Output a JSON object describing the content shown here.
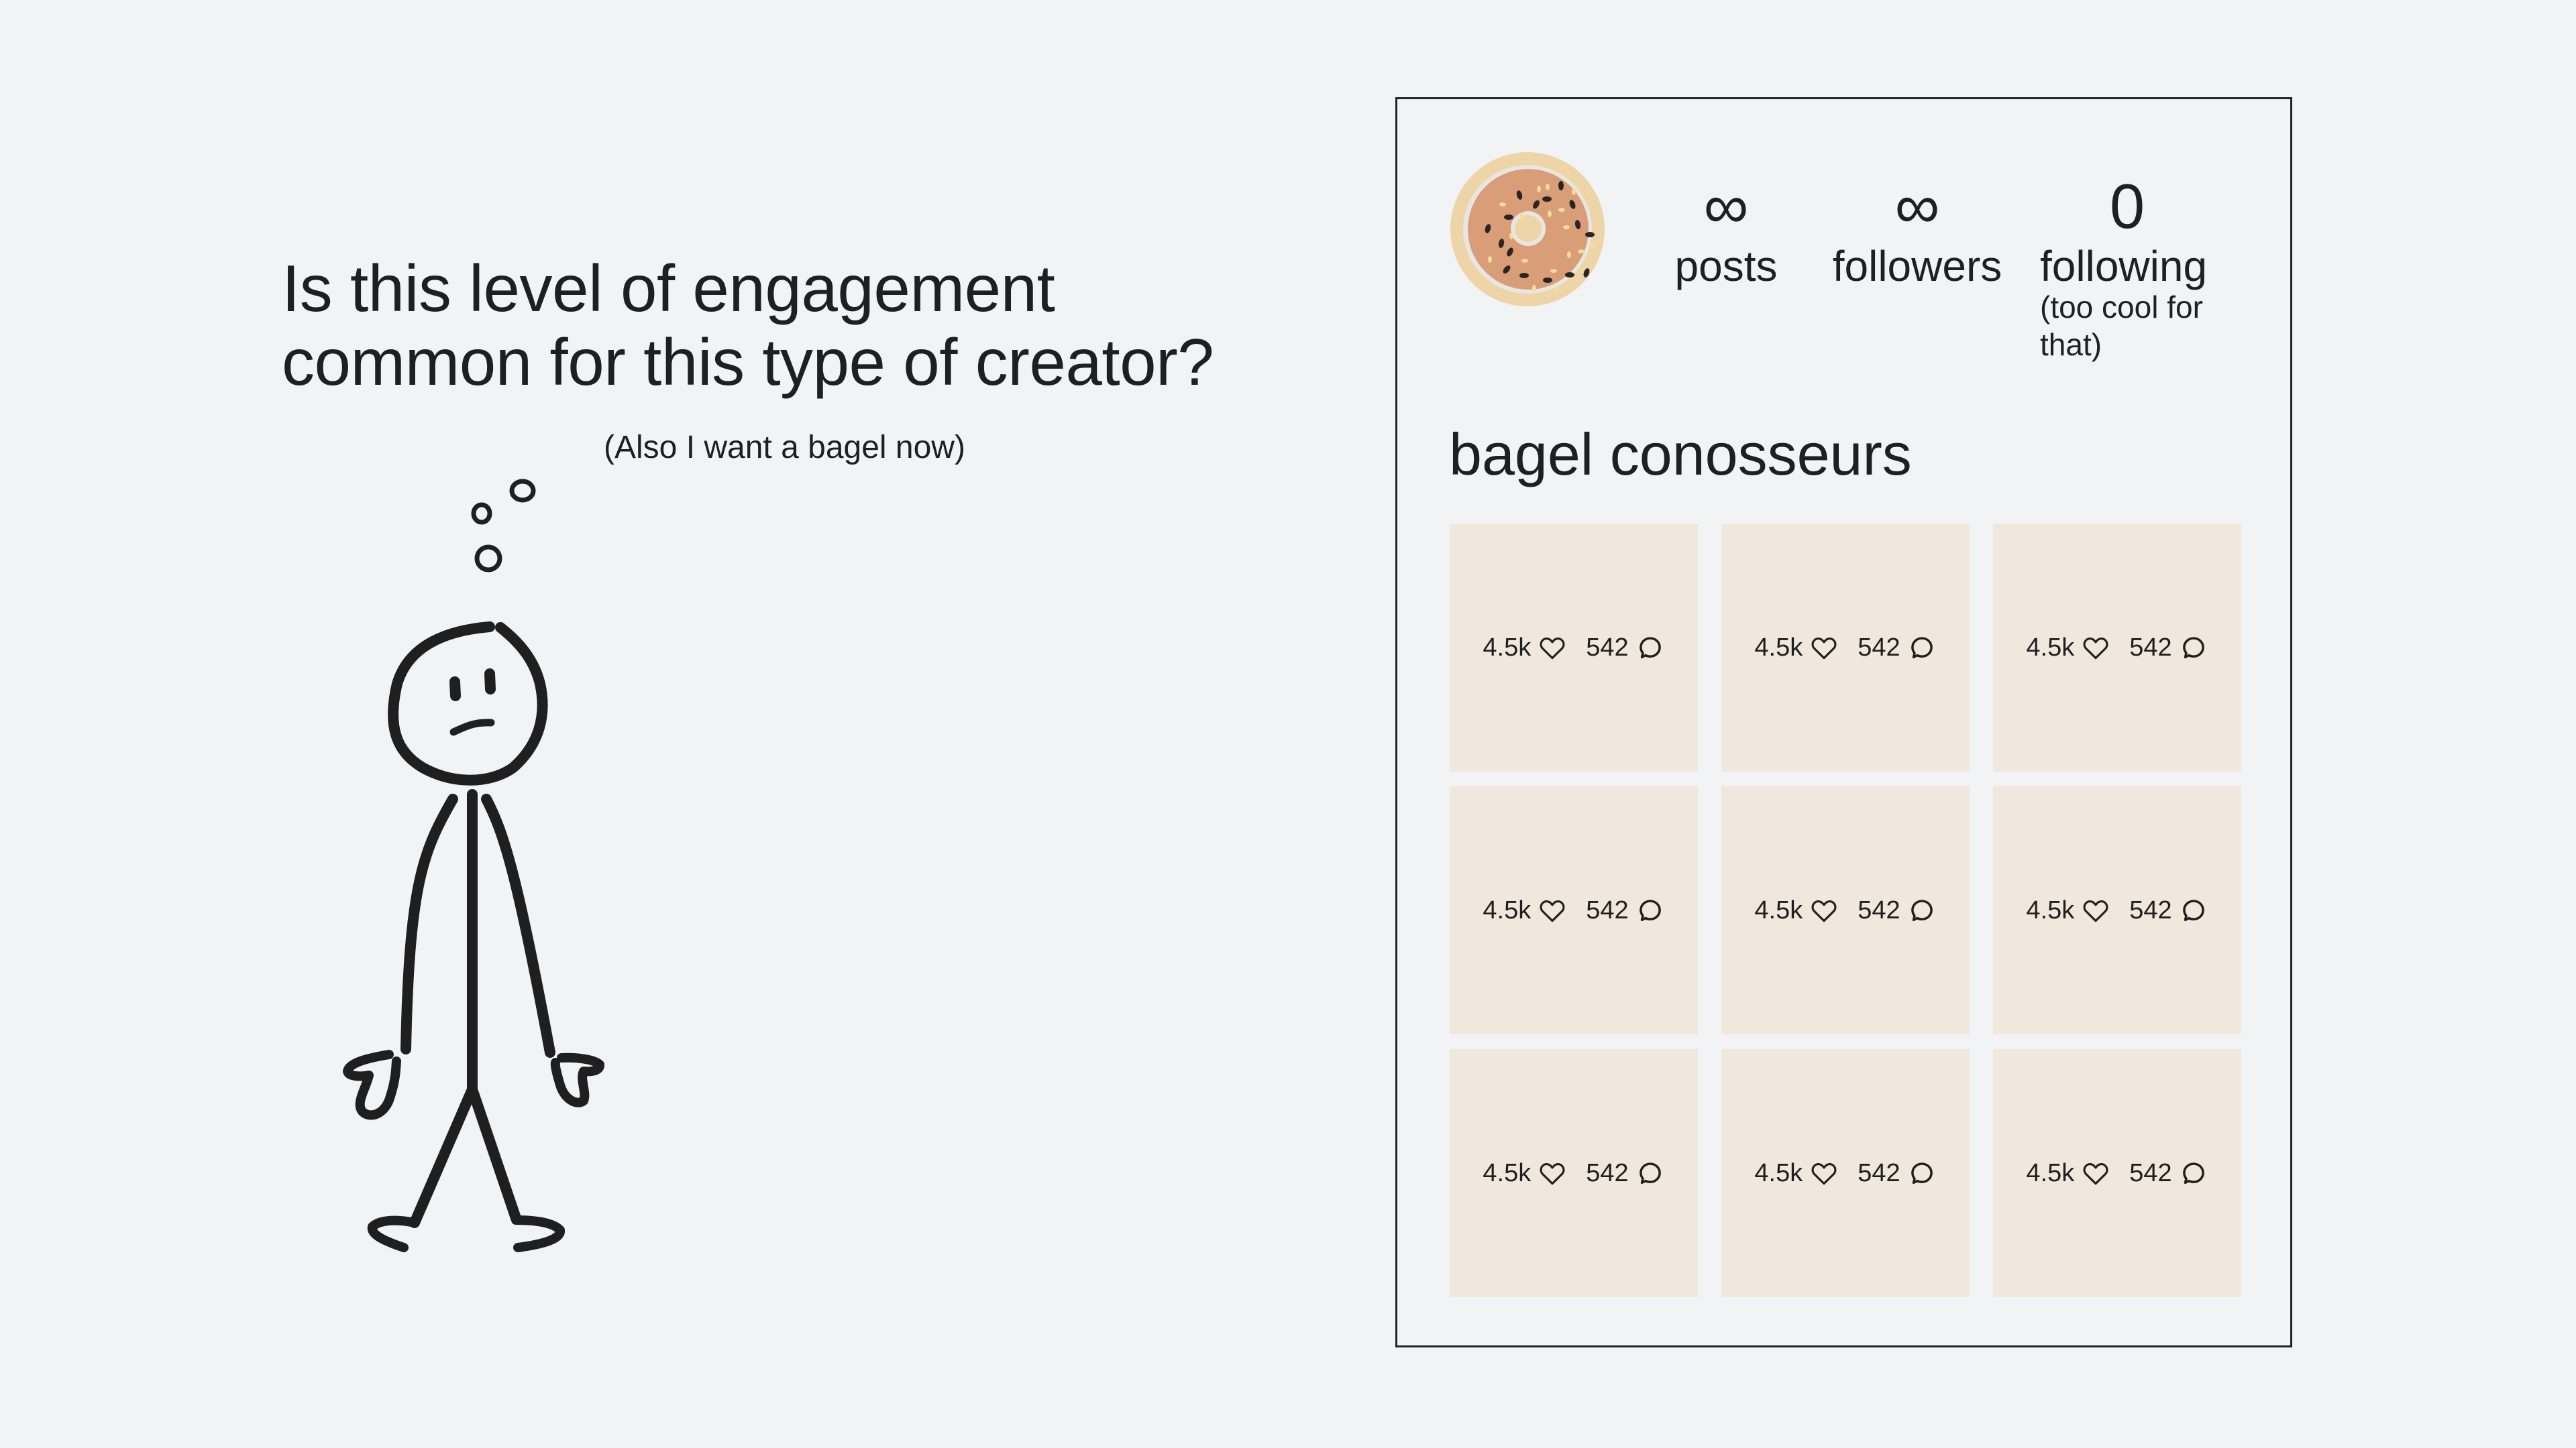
{
  "question": {
    "line1": "Is this level of engagement",
    "line2": "common for this type of creator?",
    "aside": "(Also I want a bagel now)"
  },
  "figure": {
    "icon": "stick-figure-thinking",
    "expression": "puzzled",
    "thought_bubbles": 3
  },
  "profile": {
    "avatar_icon": "bagel-icon",
    "name": "bagel conosseurs",
    "stats": {
      "posts": {
        "value": "∞",
        "label": "posts"
      },
      "followers": {
        "value": "∞",
        "label": "followers"
      },
      "following": {
        "value": "0",
        "label": "following",
        "note": "(too cool for that)"
      }
    },
    "posts": [
      {
        "likes": "4.5k",
        "comments": "542"
      },
      {
        "likes": "4.5k",
        "comments": "542"
      },
      {
        "likes": "4.5k",
        "comments": "542"
      },
      {
        "likes": "4.5k",
        "comments": "542"
      },
      {
        "likes": "4.5k",
        "comments": "542"
      },
      {
        "likes": "4.5k",
        "comments": "542"
      },
      {
        "likes": "4.5k",
        "comments": "542"
      },
      {
        "likes": "4.5k",
        "comments": "542"
      },
      {
        "likes": "4.5k",
        "comments": "542"
      }
    ]
  },
  "colors": {
    "background": "#f2f3f5",
    "ink": "#1f1f1f",
    "tile": "#f0e8dc",
    "bagel_crust": "#d99e78",
    "bagel_rim": "#eed5a7",
    "bagel_ring": "#e8e6e3",
    "seed_dark": "#2a2522",
    "seed_light": "#f6dc9a"
  }
}
